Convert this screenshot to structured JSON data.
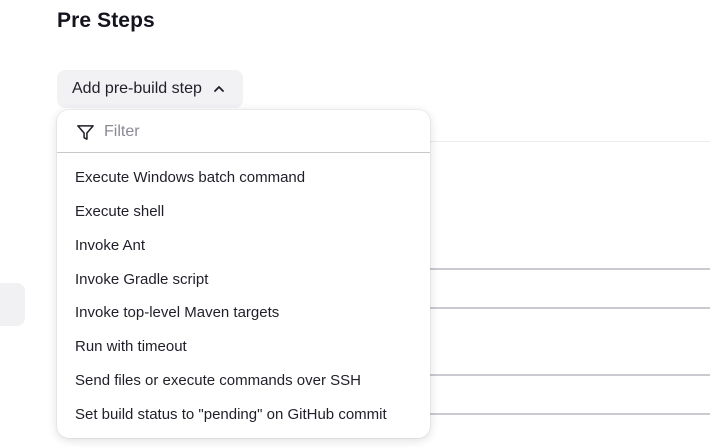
{
  "section": {
    "title": "Pre Steps"
  },
  "add_step": {
    "label": "Add pre-build step",
    "icon": "chevron-up-icon"
  },
  "dropdown": {
    "filter_placeholder": "Filter",
    "filter_value": "",
    "filter_icon": "funnel-filter-icon",
    "items": [
      {
        "label": "Execute Windows batch command"
      },
      {
        "label": "Execute shell"
      },
      {
        "label": "Invoke Ant"
      },
      {
        "label": "Invoke Gradle script"
      },
      {
        "label": "Invoke top-level Maven targets"
      },
      {
        "label": "Run with timeout"
      },
      {
        "label": "Send files or execute commands over SSH",
        "highlighted": true
      },
      {
        "label": "Set build status to \"pending\" on GitHub commit"
      }
    ]
  },
  "colors": {
    "highlight_border": "#d7262e",
    "button_bg": "#f2f2f4"
  }
}
